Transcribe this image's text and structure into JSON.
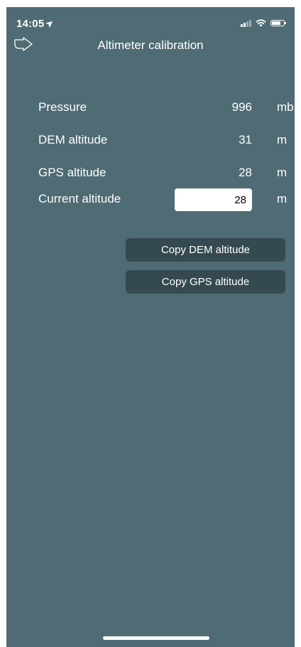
{
  "status_bar": {
    "time": "14:05",
    "location_icon": "location-arrow-icon",
    "signal_icon": "cellular-signal-icon",
    "wifi_icon": "wifi-icon",
    "battery_icon": "battery-icon"
  },
  "nav": {
    "back_icon": "back-arrow-icon",
    "title": "Altimeter calibration"
  },
  "rows": {
    "pressure": {
      "label": "Pressure",
      "value": "996",
      "unit": "mb"
    },
    "dem": {
      "label": "DEM altitude",
      "value": "31",
      "unit": "m"
    },
    "gps": {
      "label": "GPS altitude",
      "value": "28",
      "unit": "m"
    },
    "current": {
      "label": "Current altitude",
      "value": "28",
      "unit": "m"
    }
  },
  "buttons": {
    "copy_dem": "Copy DEM altitude",
    "copy_gps": "Copy GPS altitude"
  },
  "colors": {
    "background": "#4f6b74",
    "button": "#344a50",
    "text": "#ffffff"
  }
}
